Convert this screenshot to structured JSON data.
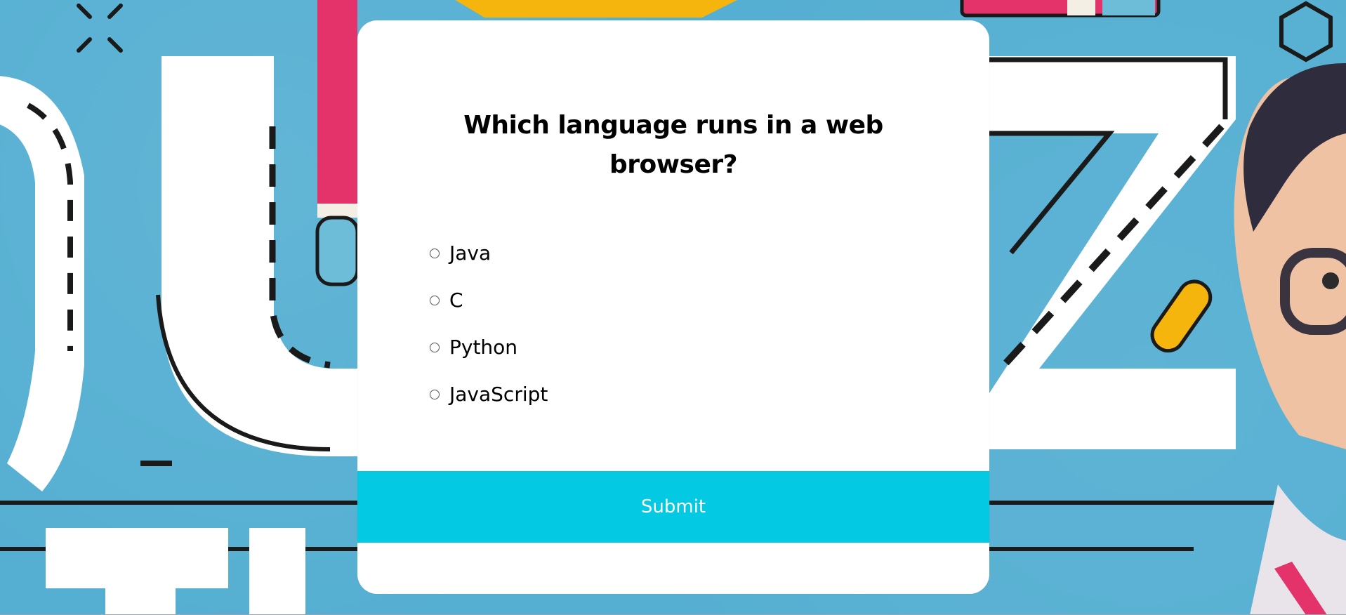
{
  "background": {
    "image": "quiz-time-illustration",
    "base_color": "#55afd2"
  },
  "quiz": {
    "question": "Which language runs in a web browser?",
    "answers": [
      {
        "label": "Java",
        "selected": false
      },
      {
        "label": "C",
        "selected": false
      },
      {
        "label": "Python",
        "selected": false
      },
      {
        "label": "JavaScript",
        "selected": false
      }
    ],
    "submit_label": "Submit"
  },
  "colors": {
    "card": "#ffffff",
    "submit": "#03c9e3",
    "submit_text": "#ffffff",
    "text": "#000000"
  }
}
